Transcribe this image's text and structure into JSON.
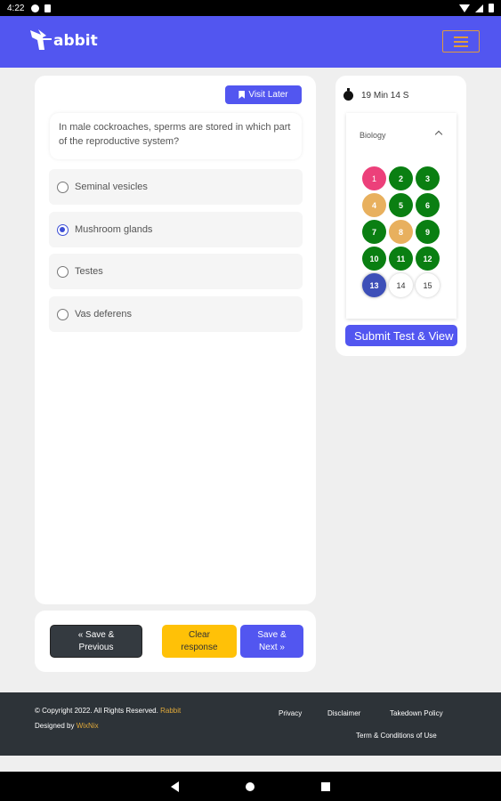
{
  "status_bar": {
    "time": "4:22"
  },
  "header": {
    "logo_text": "abbit",
    "colors": {
      "brand": "#5256f0",
      "menu": "#e09b3d"
    }
  },
  "question": {
    "visit_later_label": "Visit Later",
    "text": "In male cockroaches, sperms are stored in which part of the reproductive system?",
    "options": [
      {
        "label": "Seminal vesicles",
        "selected": false
      },
      {
        "label": "Mushroom glands",
        "selected": true
      },
      {
        "label": "Testes",
        "selected": false
      },
      {
        "label": "Vas deferens",
        "selected": false
      }
    ]
  },
  "navigation": {
    "prev_label": "« Save & Previous",
    "clear_label": "Clear response",
    "next_label": "Save & Next »"
  },
  "side": {
    "timer": "19 Min 14 S",
    "subject": "Biology",
    "questions": [
      {
        "n": "1",
        "state": "skipped"
      },
      {
        "n": "2",
        "state": "answered"
      },
      {
        "n": "3",
        "state": "answered"
      },
      {
        "n": "4",
        "state": "marked"
      },
      {
        "n": "5",
        "state": "answered"
      },
      {
        "n": "6",
        "state": "answered"
      },
      {
        "n": "7",
        "state": "answered"
      },
      {
        "n": "8",
        "state": "marked"
      },
      {
        "n": "9",
        "state": "answered"
      },
      {
        "n": "10",
        "state": "answered"
      },
      {
        "n": "11",
        "state": "answered"
      },
      {
        "n": "12",
        "state": "answered"
      },
      {
        "n": "13",
        "state": "current"
      },
      {
        "n": "14",
        "state": "notvisited"
      },
      {
        "n": "15",
        "state": "notvisited"
      }
    ],
    "submit_label": "Submit Test & View Result"
  },
  "footer": {
    "copyright": "© Copyright 2022. All Rights Reserved.",
    "brand": "Rabbit",
    "designed_by": "Designed by",
    "designer": "WixNix",
    "links": [
      "Privacy",
      "Disclaimer",
      "Takedown Policy",
      "Term & Conditions of Use"
    ]
  }
}
